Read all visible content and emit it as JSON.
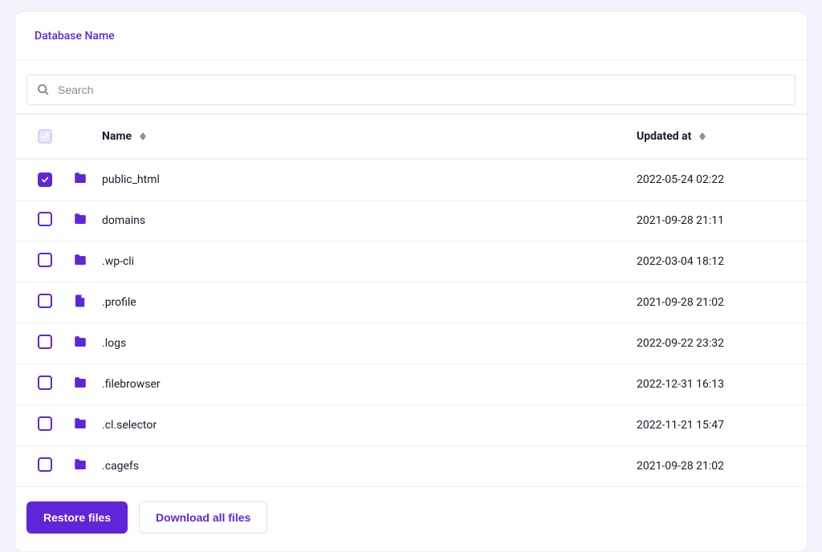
{
  "colors": {
    "accent": "#5f26d9"
  },
  "tabs": {
    "databaseName": "Database Name"
  },
  "search": {
    "placeholder": "Search",
    "value": ""
  },
  "table": {
    "headers": {
      "name": "Name",
      "updated": "Updated at"
    },
    "rows": [
      {
        "checked": true,
        "type": "folder",
        "name": "public_html",
        "updated": "2022-05-24 02:22"
      },
      {
        "checked": false,
        "type": "folder",
        "name": "domains",
        "updated": "2021-09-28 21:11"
      },
      {
        "checked": false,
        "type": "folder",
        "name": ".wp-cli",
        "updated": "2022-03-04 18:12"
      },
      {
        "checked": false,
        "type": "file",
        "name": ".profile",
        "updated": "2021-09-28 21:02"
      },
      {
        "checked": false,
        "type": "folder",
        "name": ".logs",
        "updated": "2022-09-22 23:32"
      },
      {
        "checked": false,
        "type": "folder",
        "name": ".filebrowser",
        "updated": "2022-12-31 16:13"
      },
      {
        "checked": false,
        "type": "folder",
        "name": ".cl.selector",
        "updated": "2022-11-21 15:47"
      },
      {
        "checked": false,
        "type": "folder",
        "name": ".cagefs",
        "updated": "2021-09-28 21:02"
      }
    ]
  },
  "footer": {
    "restore": "Restore files",
    "downloadAll": "Download all files"
  }
}
